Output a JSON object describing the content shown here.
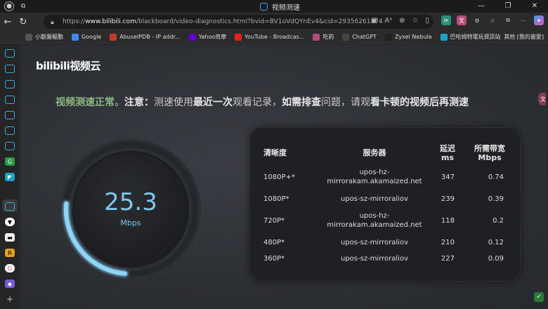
{
  "window": {
    "tab_title": "视频测速",
    "controls": [
      "—",
      "❐",
      "✕"
    ]
  },
  "address_bar": {
    "url_prefix": "https://",
    "url_host": "www.bilibili.com",
    "url_path": "/blackboard/video-diagnostics.html?bvid=BV1oVdQYnEv4&cid=29356261474"
  },
  "bookmarks": [
    {
      "label": "小獸盤驅動",
      "icon": "puzzle-icon",
      "color": "#555555"
    },
    {
      "label": "Google",
      "icon": "google-icon",
      "color": "#4285f4"
    },
    {
      "label": "AbuseIPDB - IP addr...",
      "icon": "abuseipdb-icon",
      "color": "#c0392b"
    },
    {
      "label": "Yahoo奇摩",
      "icon": "yahoo-icon",
      "color": "#6001d2"
    },
    {
      "label": "YouTube - Broadcas...",
      "icon": "youtube-icon",
      "color": "#e62117"
    },
    {
      "label": "吃葯",
      "icon": "pill-icon",
      "color": "#b34a7a"
    },
    {
      "label": "ChatGPT",
      "icon": "chatgpt-icon",
      "color": "#444444"
    },
    {
      "label": "Zyxel Nebula",
      "icon": "zyxel-icon",
      "color": "#222222"
    },
    {
      "label": "巴哈姆特電玩資訊站",
      "icon": "bahamut-icon",
      "color": "#1aa3c8"
    }
  ],
  "bookmarks_other": "其他 [我的最愛]",
  "page": {
    "logo": "bilibili视频云",
    "notice_ok": "视频测速正常",
    "notice_sep": "。",
    "notice_label": "注意：",
    "notice_body_1": "测速使用",
    "notice_body_2": "最近一次",
    "notice_body_3": "观看",
    "notice_body_4": "记录，",
    "notice_body_5": "如需排查",
    "notice_body_6": "问题，请观",
    "notice_body_7": "看卡顿的视频后再测速"
  },
  "gauge": {
    "speed": "25.3",
    "unit": "Mbps",
    "arc_fraction": 0.25,
    "accent": "#7ec8ee"
  },
  "table": {
    "headers": {
      "quality": "清晰度",
      "server": "服务器",
      "latency_1": "延迟",
      "latency_2": "ms",
      "bandwidth_1": "所需带宽",
      "bandwidth_2": "Mbps"
    },
    "rows": [
      {
        "quality": "1080P+*",
        "server_1": "upos-hz-",
        "server_2": "mirrorakam.akamaized.net",
        "latency": "347",
        "bandwidth": "0.74"
      },
      {
        "quality": "1080P*",
        "server_1": "upos-sz-mirroraliov",
        "server_2": "",
        "latency": "239",
        "bandwidth": "0.39"
      },
      {
        "quality": "720P*",
        "server_1": "upos-hz-",
        "server_2": "mirrorakam.akamaized.net",
        "latency": "118",
        "bandwidth": "0.2"
      },
      {
        "quality": "480P*",
        "server_1": "upos-sz-mirroraliov",
        "server_2": "",
        "latency": "210",
        "bandwidth": "0.12"
      },
      {
        "quality": "360P*",
        "server_1": "upos-sz-mirroraliov",
        "server_2": "",
        "latency": "227",
        "bandwidth": "0.09"
      }
    ]
  }
}
